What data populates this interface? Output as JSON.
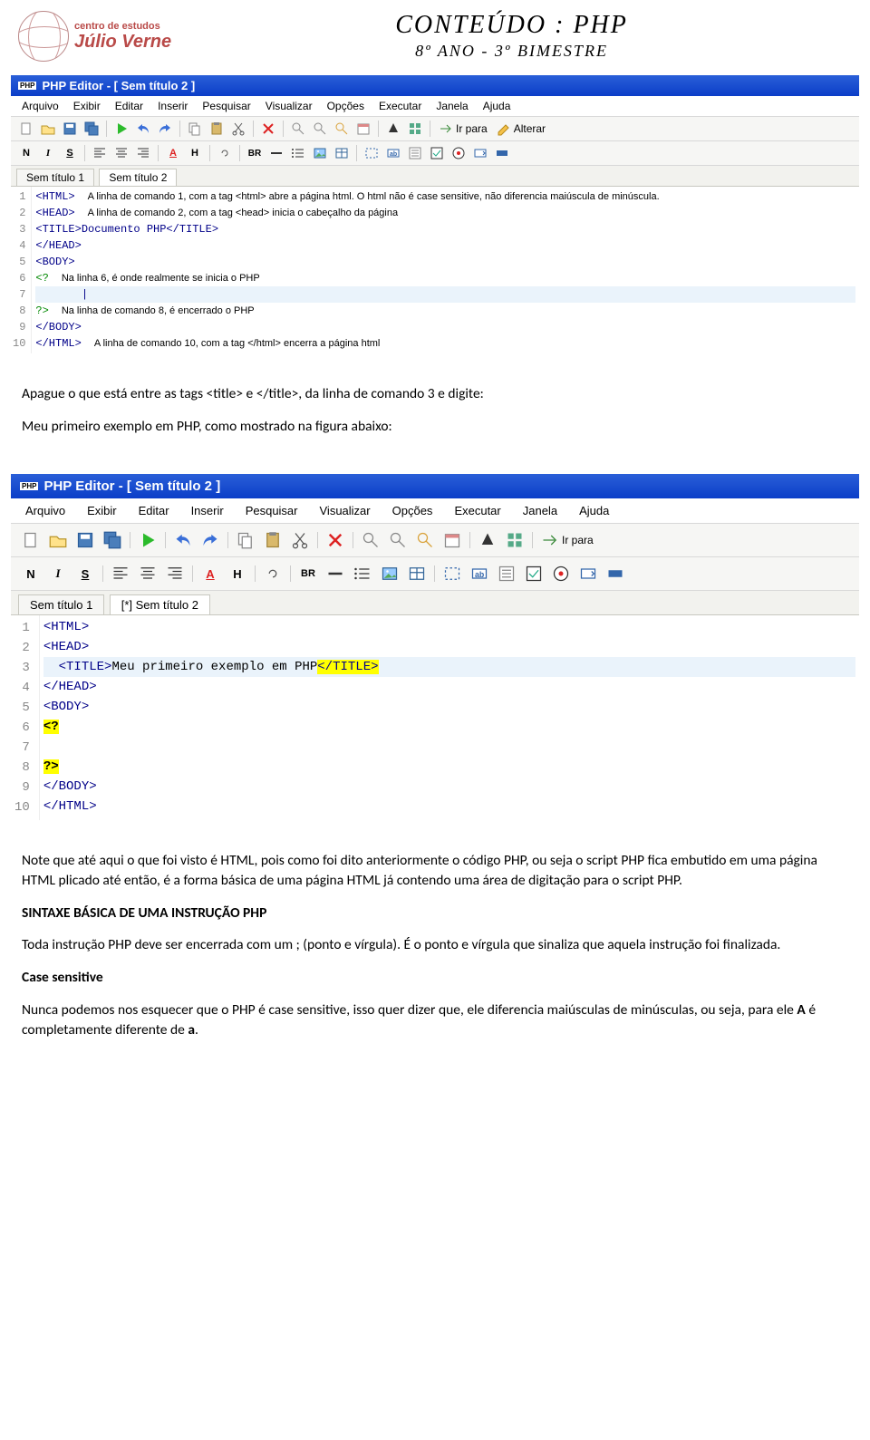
{
  "header": {
    "logo_line1": "centro de estudos",
    "logo_line2": "Júlio Verne",
    "title": "CONTEÚDO :  PHP",
    "subtitle": "8º ANO -  3º BIMESTRE"
  },
  "editor_common": {
    "php_badge": "PHP",
    "title": "PHP Editor - [ Sem título 2 ]",
    "menu": [
      "Arquivo",
      "Exibir",
      "Editar",
      "Inserir",
      "Pesquisar",
      "Visualizar",
      "Opções",
      "Executar",
      "Janela",
      "Ajuda"
    ],
    "tb_text": {
      "irpara": "Ir para",
      "alterar": "Alterar"
    },
    "fmt": {
      "N": "N",
      "I": "I",
      "S": "S",
      "A": "A",
      "H": "H",
      "BR": "BR"
    }
  },
  "editor1": {
    "tabs": [
      "Sem título 1",
      "Sem título 2"
    ],
    "active_tab_index": 1,
    "lines": [
      {
        "n": "1",
        "code": "<HTML>",
        "note": "A linha de comando 1, com a tag <html> abre a página html. O html não é case sensitive, não diferencia maiúscula de minúscula."
      },
      {
        "n": "2",
        "code": "<HEAD>",
        "note": "A linha de comando 2, com a tag <head> inicia o cabeçalho da página"
      },
      {
        "n": "3",
        "code": "<TITLE>Documento PHP</TITLE>",
        "note": ""
      },
      {
        "n": "4",
        "code": "</HEAD>",
        "note": ""
      },
      {
        "n": "5",
        "code": "<BODY>",
        "note": ""
      },
      {
        "n": "6",
        "code": "<?",
        "note": "Na linha 6, é onde realmente se inicia o PHP"
      },
      {
        "n": "7",
        "code": "       |",
        "note": ""
      },
      {
        "n": "8",
        "code": "?>",
        "note": "Na linha de comando 8, é encerrado o PHP"
      },
      {
        "n": "9",
        "code": "</BODY>",
        "note": ""
      },
      {
        "n": "10",
        "code": "</HTML>",
        "note": "A linha de comando 10, com a tag </html> encerra a página html"
      }
    ]
  },
  "body_text": {
    "p1": "Apague o que está entre as tags <title> e </title>, da linha de comando 3 e digite:",
    "p2": "Meu primeiro exemplo em PHP, como mostrado na figura abaixo:"
  },
  "editor2": {
    "tabs": [
      "Sem título 1",
      "[*] Sem título 2"
    ],
    "active_tab_index": 1,
    "lines": [
      {
        "n": "1",
        "code_parts": [
          {
            "t": "tag",
            "v": "<HTML>"
          }
        ]
      },
      {
        "n": "2",
        "code_parts": [
          {
            "t": "tag",
            "v": "<HEAD>"
          }
        ]
      },
      {
        "n": "3",
        "code_parts": [
          {
            "t": "plain",
            "v": "  "
          },
          {
            "t": "tag",
            "v": "<TITLE>"
          },
          {
            "t": "plain",
            "v": "Meu primeiro exemplo em PHP"
          },
          {
            "t": "hl",
            "v": "</TITLE>"
          }
        ],
        "cursor": true
      },
      {
        "n": "4",
        "code_parts": [
          {
            "t": "tag",
            "v": "</HEAD>"
          }
        ]
      },
      {
        "n": "5",
        "code_parts": [
          {
            "t": "tag",
            "v": "<BODY>"
          }
        ]
      },
      {
        "n": "6",
        "code_parts": [
          {
            "t": "hlphp",
            "v": "<?"
          }
        ]
      },
      {
        "n": "7",
        "code_parts": []
      },
      {
        "n": "8",
        "code_parts": [
          {
            "t": "hlphp",
            "v": "?>"
          }
        ]
      },
      {
        "n": "9",
        "code_parts": [
          {
            "t": "tag",
            "v": "</BODY>"
          }
        ]
      },
      {
        "n": "10",
        "code_parts": [
          {
            "t": "tag",
            "v": "</HTML>"
          }
        ]
      }
    ]
  },
  "body_text2": {
    "p3": "Note que até aqui o que foi visto é HTML, pois como foi dito anteriormente o código PHP, ou seja o script PHP fica embutido em uma página  HTML plicado até então, é a forma básica de uma página HTML já contendo uma área de digitação para o script PHP.",
    "h1": "SINTAXE BÁSICA DE UMA INSTRUÇÃO PHP",
    "p4": "Toda instrução PHP deve ser encerrada com um  ; (ponto e vírgula). É o ponto e vírgula que sinaliza que aquela instrução foi finalizada.",
    "h2": "Case sensitive",
    "p5_a": "Nunca podemos nos esquecer que o PHP é case sensitive, isso quer dizer que, ele diferencia maiúsculas de minúsculas, ou seja, para ele   ",
    "p5_bold1": "A",
    "p5_b": "   é completamente diferente de ",
    "p5_bold2": "a",
    "p5_c": "."
  }
}
